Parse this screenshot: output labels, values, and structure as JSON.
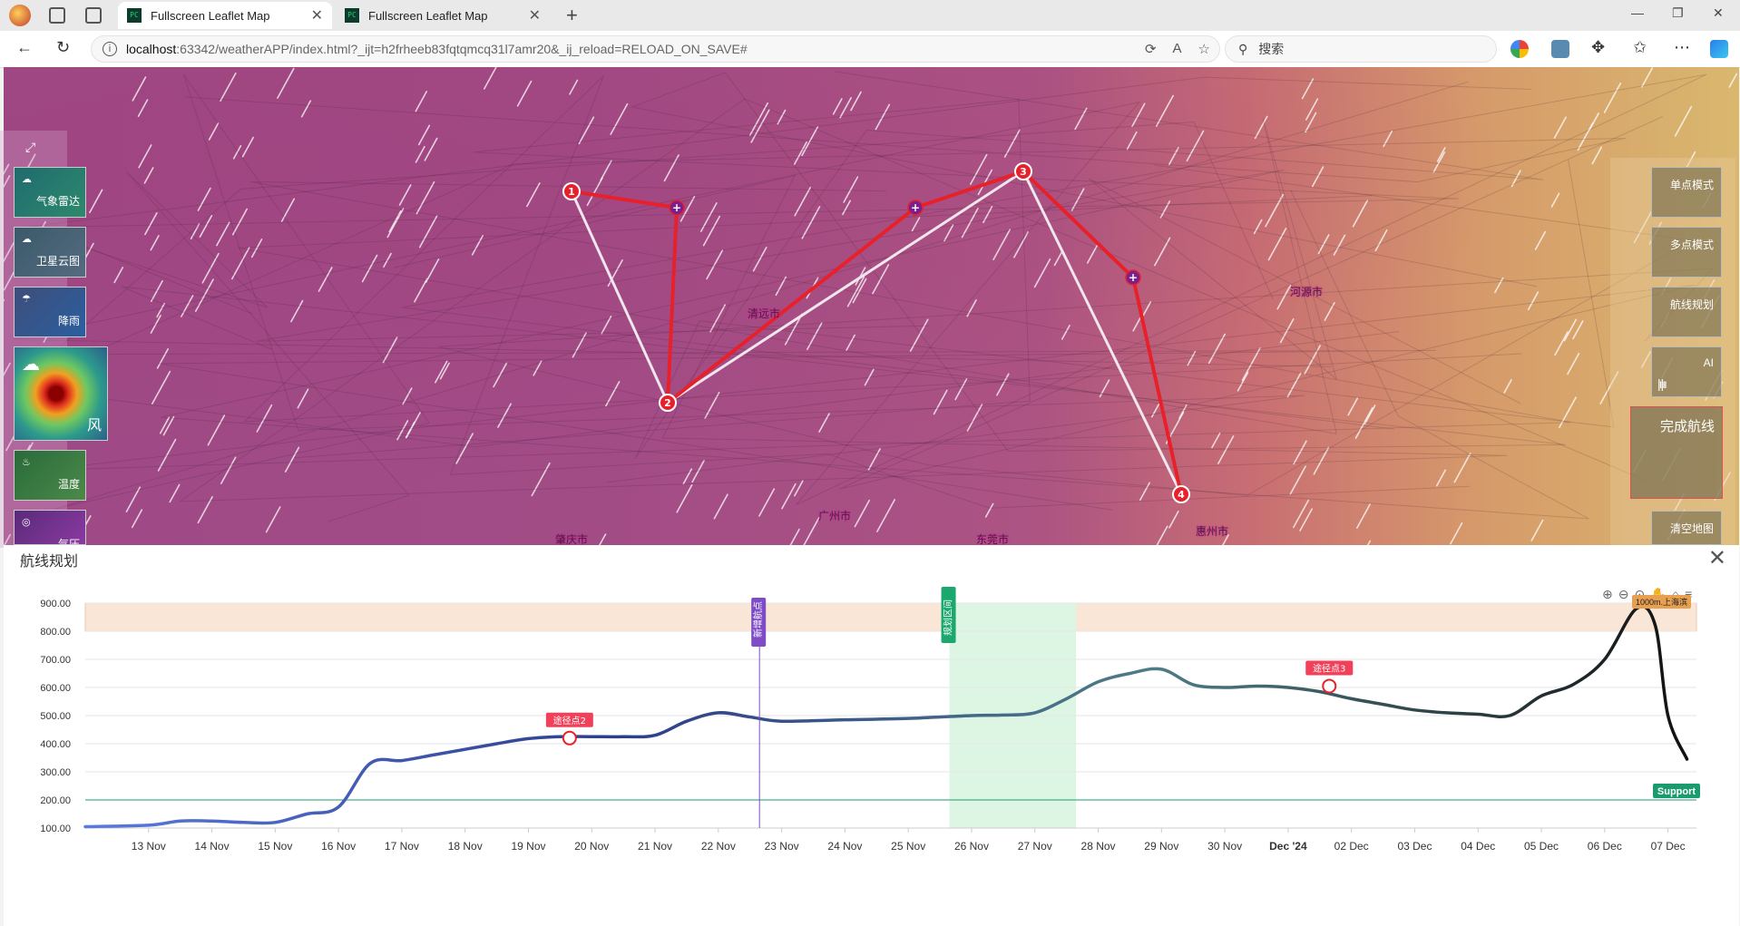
{
  "browser": {
    "tabs": [
      {
        "title": "Fullscreen Leaflet Map",
        "active": true
      },
      {
        "title": "Fullscreen Leaflet Map",
        "active": false
      }
    ],
    "favicon_text": "PC",
    "url_host": "localhost",
    "url_rest": ":63342/weatherAPP/index.html?_ijt=h2frheeb83fqtqmcq31l7amr20&_ij_reload=RELOAD_ON_SAVE#",
    "search_placeholder": "搜索"
  },
  "map": {
    "cities": [
      "清远市",
      "河源市",
      "广州市",
      "惠州市",
      "肇庆市",
      "东莞市"
    ],
    "waypoints": [
      "1",
      "2",
      "3",
      "4"
    ],
    "route_color": "#e8202a",
    "direct_line_color": "#f0e6ee",
    "midpoint_color": "#7a1f8c"
  },
  "left_layers": [
    {
      "label": "气象雷达",
      "icon": "radar-icon"
    },
    {
      "label": "卫星云图",
      "icon": "cloud-icon"
    },
    {
      "label": "降雨",
      "icon": "rain-icon"
    },
    {
      "label": "风",
      "icon": "wind-icon"
    },
    {
      "label": "温度",
      "icon": "thermometer-icon"
    },
    {
      "label": "气压",
      "icon": "pressure-icon"
    }
  ],
  "right_modes": [
    {
      "label": "单点模式"
    },
    {
      "label": "多点模式"
    },
    {
      "label": "航线规划"
    },
    {
      "label": "AI"
    },
    {
      "label": "完成航线"
    },
    {
      "label": "清空地图"
    }
  ],
  "chart_panel": {
    "title": "航线规划",
    "toolbar_tooltip": "1000m.上海滨"
  },
  "chart_data": {
    "type": "line",
    "title": "",
    "xlabel": "",
    "ylabel": "",
    "ylim": [
      100,
      900
    ],
    "y_ticks": [
      "900.00",
      "800.00",
      "700.00",
      "600.00",
      "500.00",
      "400.00",
      "300.00",
      "200.00",
      "100.00"
    ],
    "x_ticks": [
      "13 Nov",
      "14 Nov",
      "15 Nov",
      "16 Nov",
      "17 Nov",
      "18 Nov",
      "19 Nov",
      "20 Nov",
      "21 Nov",
      "22 Nov",
      "23 Nov",
      "24 Nov",
      "25 Nov",
      "26 Nov",
      "27 Nov",
      "28 Nov",
      "29 Nov",
      "30 Nov",
      "Dec '24",
      "02 Dec",
      "03 Dec",
      "04 Dec",
      "05 Dec",
      "06 Dec",
      "07 Dec"
    ],
    "series": [
      {
        "x": [
          12.0,
          13.0,
          13.5,
          14.0,
          14.5,
          15.0,
          15.5,
          16.0,
          16.5,
          17.0,
          17.5,
          18.0,
          18.5,
          19.0,
          19.5,
          20.0,
          20.5,
          21.0,
          21.5,
          22.0,
          22.5,
          23.0,
          24.0,
          25.0,
          26.0,
          26.5,
          27.0,
          27.5,
          28.0,
          28.5,
          29.0,
          29.5,
          30.0,
          30.5,
          31.0,
          31.5,
          32.0,
          32.5,
          33.0,
          33.5,
          34.0,
          34.5,
          35.0,
          35.5,
          36.0,
          36.5,
          36.8,
          37.0,
          37.3
        ],
        "values": [
          105,
          110,
          125,
          125,
          120,
          120,
          150,
          175,
          330,
          340,
          360,
          380,
          400,
          418,
          425,
          425,
          425,
          430,
          480,
          510,
          495,
          480,
          485,
          490,
          500,
          502,
          510,
          560,
          620,
          650,
          665,
          610,
          600,
          605,
          600,
          585,
          560,
          540,
          520,
          510,
          505,
          500,
          570,
          610,
          700,
          880,
          820,
          500,
          345
        ]
      }
    ],
    "bands": [
      {
        "from": 800,
        "to": 900,
        "axis": "y",
        "color": "#fae6d6"
      },
      {
        "from": 25.65,
        "to": 27.65,
        "axis": "x",
        "color": "#ddf6e3"
      }
    ],
    "support_line": {
      "y": 200,
      "label": "Support",
      "color": "#1a9b6e"
    },
    "vertical_lines": [
      {
        "x": 22.65,
        "label": "新增航点",
        "color": "#7d4cc6"
      },
      {
        "x": 25.65,
        "label": "规划区间",
        "color": "#1aa86e"
      }
    ],
    "point_annotations": [
      {
        "x": 19.65,
        "y": 420,
        "label": "途径点2"
      },
      {
        "x": 31.65,
        "y": 605,
        "label": "途径点3"
      }
    ],
    "line_gradient": [
      "#5b7ae0",
      "#2c3e8a",
      "#4f7d86",
      "#111111"
    ]
  }
}
